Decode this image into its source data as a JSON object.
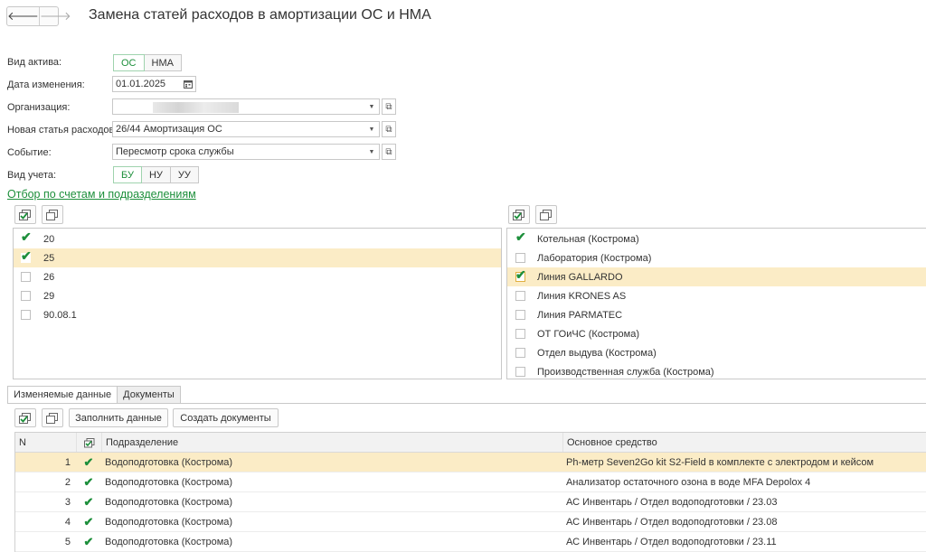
{
  "window": {
    "title": "Замена статей расходов в амортизации ОС и НМА",
    "nav_back": "🡐",
    "nav_forward": "🡒"
  },
  "form": {
    "asset_type": {
      "label": "Вид актива:",
      "options": [
        "ОС",
        "НМА"
      ],
      "selected": "ОС"
    },
    "change_date": {
      "label": "Дата изменения:",
      "value": "01.01.2025"
    },
    "organization": {
      "label": "Организация:",
      "value": ""
    },
    "new_expense_item": {
      "label": "Новая статья расходов:",
      "value": "26/44 Амортизация ОС"
    },
    "event": {
      "label": "Событие:",
      "value": "Пересмотр срока службы"
    },
    "accounting_type": {
      "label": "Вид учета:",
      "options": [
        "БУ",
        "НУ",
        "УУ"
      ],
      "selected": "БУ"
    }
  },
  "filter_link": "Отбор по счетам и подразделениям",
  "accounts": [
    {
      "code": "20",
      "checked": true,
      "selected": false
    },
    {
      "code": "25",
      "checked": true,
      "selected": true
    },
    {
      "code": "26",
      "checked": false,
      "selected": false
    },
    {
      "code": "29",
      "checked": false,
      "selected": false
    },
    {
      "code": "90.08.1",
      "checked": false,
      "selected": false
    }
  ],
  "departments": [
    {
      "name": "Котельная (Кострома)",
      "checked": true,
      "selected": false
    },
    {
      "name": "Лаборатория (Кострома)",
      "checked": false,
      "selected": false
    },
    {
      "name": "Линия GALLARDO",
      "checked": true,
      "selected": true
    },
    {
      "name": "Линия KRONES AS",
      "checked": false,
      "selected": false
    },
    {
      "name": "Линия PARMATEC",
      "checked": false,
      "selected": false
    },
    {
      "name": "ОТ ГОиЧС (Кострома)",
      "checked": false,
      "selected": false
    },
    {
      "name": "Отдел выдува (Кострома)",
      "checked": false,
      "selected": false
    },
    {
      "name": "Производственная служба (Кострома)",
      "checked": false,
      "selected": false
    }
  ],
  "tabs": [
    {
      "label": "Изменяемые данные",
      "active": true
    },
    {
      "label": "Документы",
      "active": false
    }
  ],
  "toolbar": {
    "fill_label": "Заполнить данные",
    "create_label": "Создать документы"
  },
  "table": {
    "columns": {
      "n": "N",
      "subdivision": "Подразделение",
      "asset": "Основное средство"
    },
    "rows": [
      {
        "n": "1",
        "checked": true,
        "subdivision": "Водоподготовка (Кострома)",
        "asset": "Ph-метр Seven2Go kit S2-Field в комплекте с электродом и кейсом",
        "selected": true
      },
      {
        "n": "2",
        "checked": true,
        "subdivision": "Водоподготовка (Кострома)",
        "asset": "Анализатор остаточного озона в воде MFA Depolox 4",
        "selected": false
      },
      {
        "n": "3",
        "checked": true,
        "subdivision": "Водоподготовка (Кострома)",
        "asset": "АС Инвентарь / Отдел водоподготовки / 23.03",
        "selected": false
      },
      {
        "n": "4",
        "checked": true,
        "subdivision": "Водоподготовка (Кострома)",
        "asset": "АС Инвентарь / Отдел водоподготовки / 23.08",
        "selected": false
      },
      {
        "n": "5",
        "checked": true,
        "subdivision": "Водоподготовка (Кострома)",
        "asset": "АС Инвентарь / Отдел водоподготовки / 23.11",
        "selected": false
      }
    ]
  },
  "colors": {
    "accent_green": "#1d8f3b",
    "selection": "#fbecc6"
  },
  "icons": {
    "check_all": "check-all-icon",
    "uncheck_all": "uncheck-all-icon",
    "calendar": "calendar-icon",
    "open": "open-form-icon",
    "dropdown": "chevron-down-icon"
  }
}
